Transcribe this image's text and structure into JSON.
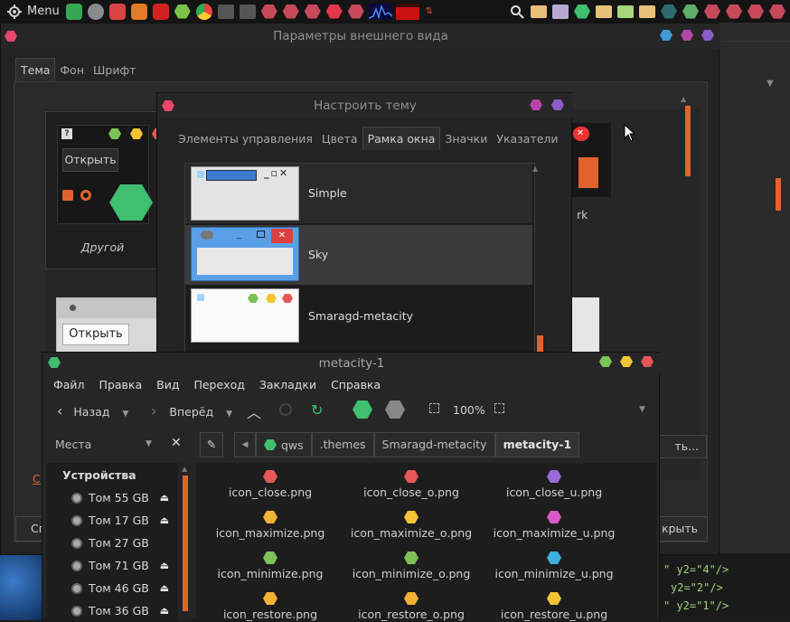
{
  "panel": {
    "menu_label": "Menu",
    "tray_icons": [
      "search-icon",
      "folder-icon",
      "document-icon",
      "hexagon-icon",
      "folder-icon",
      "folder-icon",
      "folder-icon",
      "network-icon",
      "eye-icon",
      "gear-icon",
      "gear-icon",
      "gear-icon",
      "gear-icon"
    ]
  },
  "appearance": {
    "title": "Параметры внешнего вида",
    "tabs": [
      "Тема",
      "Фон",
      "Шрифт"
    ],
    "theme_other_label": "Другой",
    "theme_dark_label_fragment": "rk",
    "open_button": "Открыть",
    "open_button2": "Открыть",
    "bottom_left_fragment": "Сг",
    "bottom_right_fragment": "крыть",
    "link_fragment": "С",
    "button_fragment": "ть..."
  },
  "customize": {
    "title": "Настроить тему",
    "tabs": [
      "Элементы управления",
      "Цвета",
      "Рамка окна",
      "Значки",
      "Указатели"
    ],
    "active_tab": "Рамка окна",
    "themes": [
      "Simple",
      "Sky",
      "Smaragd-metacity"
    ]
  },
  "files": {
    "title": "metacity-1",
    "menu": [
      "Файл",
      "Правка",
      "Вид",
      "Переход",
      "Закладки",
      "Справка"
    ],
    "toolbar": {
      "back": "Назад",
      "forward": "Вперёд",
      "zoom": "100%"
    },
    "sidebar_selector": "Места",
    "breadcrumb": [
      "qws",
      ".themes",
      "Smaragd-metacity",
      "metacity-1"
    ],
    "sidebar_header": "Устройства",
    "devices": [
      {
        "label": "Том 55 GB",
        "eject": true
      },
      {
        "label": "Том 17 GB",
        "eject": true
      },
      {
        "label": "Том 27 GB",
        "eject": false
      },
      {
        "label": "Том 71 GB",
        "eject": true
      },
      {
        "label": "Том 46 GB",
        "eject": true
      },
      {
        "label": "Том 36 GB",
        "eject": true
      }
    ],
    "items": [
      {
        "name": "icon_close.png",
        "color": "#e85757"
      },
      {
        "name": "icon_close_o.png",
        "color": "#e85757"
      },
      {
        "name": "icon_close_u.png",
        "color": "#9a6ad8"
      },
      {
        "name": "icon_maximize.png",
        "color": "#f2b233"
      },
      {
        "name": "icon_maximize_o.png",
        "color": "#f2c633"
      },
      {
        "name": "icon_maximize_u.png",
        "color": "#d85ac8"
      },
      {
        "name": "icon_minimize.png",
        "color": "#7dc258"
      },
      {
        "name": "icon_minimize_o.png",
        "color": "#7dc258"
      },
      {
        "name": "icon_minimize_u.png",
        "color": "#3fb0e0"
      },
      {
        "name": "icon_restore.png",
        "color": "#f2b233"
      },
      {
        "name": "icon_restore_o.png",
        "color": "#f2b233"
      },
      {
        "name": "icon_restore_u.png",
        "color": "#f2c633"
      }
    ]
  },
  "code": {
    "lines": [
      "\" y2=\"4\"/>",
      "y2=\"2\"/>",
      "\" y2=\"1\"/>"
    ]
  },
  "colors": {
    "accent": "#e0632d",
    "green": "#3fbf6f",
    "red": "#e23a3a"
  }
}
